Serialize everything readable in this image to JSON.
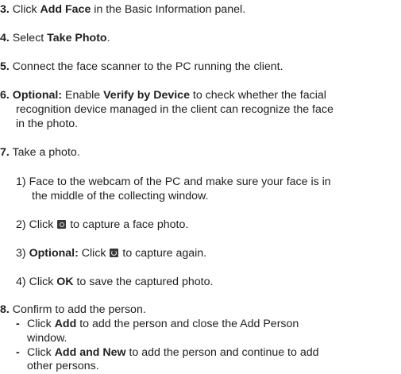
{
  "step3": {
    "num": "3.",
    "pre": "Click ",
    "bold": "Add Face",
    "post": " in the Basic Information panel."
  },
  "step4": {
    "num": "4.",
    "pre": "Select ",
    "bold": "Take Photo",
    "post": "."
  },
  "step5": {
    "num": "5.",
    "text": "Connect the face scanner to the PC running the client."
  },
  "step6": {
    "num": "6.",
    "bold1": "Optional:",
    "pre": " Enable ",
    "bold2": "Verify by Device",
    "post": " to check whether the facial",
    "line2": "recognition device managed in the client can recognize the face",
    "line3": "in the photo."
  },
  "step7": {
    "num": "7.",
    "text": "Take a photo."
  },
  "sub1": {
    "num": "1)",
    "line1": "Face to the webcam of the PC and make sure your face is in",
    "line2": "the middle of the collecting window."
  },
  "sub2": {
    "num": "2)",
    "pre": "Click ",
    "post": " to capture a face photo.",
    "icon": "camera-icon"
  },
  "sub3": {
    "num": "3)",
    "bold": "Optional:",
    "pre": " Click ",
    "post": " to capture again.",
    "icon": "retake-icon"
  },
  "sub4": {
    "num": "4)",
    "pre": "Click ",
    "bold": "OK",
    "post": " to save the captured photo."
  },
  "step8": {
    "num": "8.",
    "text": "Confirm to add the person."
  },
  "bullet1": {
    "dash": "-",
    "pre": "Click ",
    "bold": "Add",
    "post": " to add the person and close the Add Person",
    "line2": "window."
  },
  "bullet2": {
    "dash": "-",
    "pre": "Click ",
    "bold": "Add and New",
    "post": " to add the person and continue to add",
    "line2": "other persons."
  }
}
